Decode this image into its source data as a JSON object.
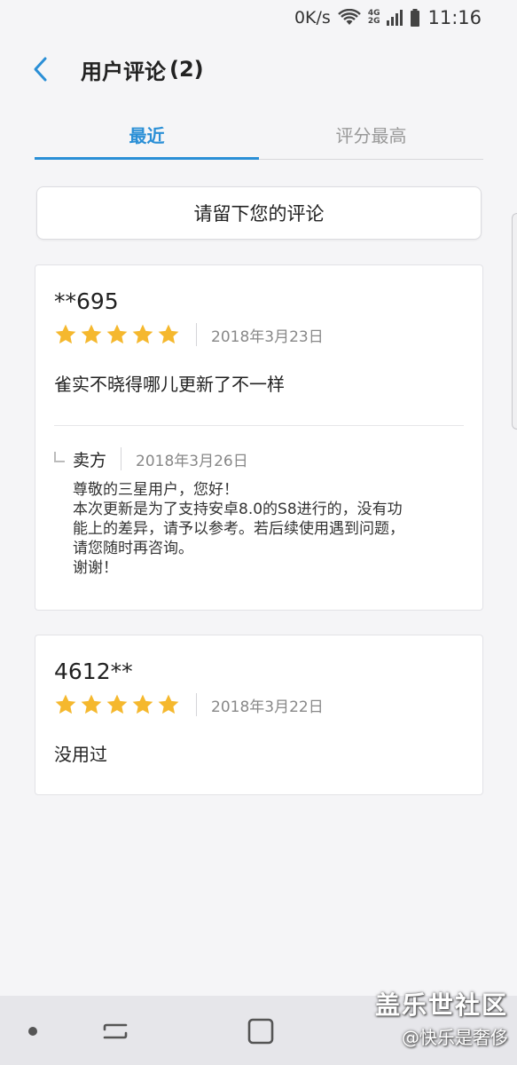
{
  "status_bar": {
    "net_speed": "0K/s",
    "network_label_top": "4G",
    "network_label_bottom": "2G",
    "time": "11:16",
    "icons": [
      "wifi-icon",
      "signal-icon",
      "battery-icon"
    ]
  },
  "header": {
    "back_icon": "chevron-left-icon",
    "title": "用户评论",
    "count": "(2)"
  },
  "tabs": [
    {
      "label": "最近",
      "active": true
    },
    {
      "label": "评分最高",
      "active": false
    }
  ],
  "leave_comment_label": "请留下您的评论",
  "reviews": [
    {
      "reviewer": "**695",
      "rating": 5,
      "max_rating": 5,
      "date": "2018年3月23日",
      "comment": "雀实不晓得哪儿更新了不一样",
      "reply": {
        "author": "卖方",
        "date": "2018年3月26日",
        "lines": [
          "尊敬的三星用户，您好！",
          "本次更新是为了支持安卓8.0的S8进行的，没有功",
          "能上的差异，请予以参考。若后续使用遇到问题，",
          "请您随时再咨询。",
          "谢谢！"
        ]
      }
    },
    {
      "reviewer": "4612**",
      "rating": 5,
      "max_rating": 5,
      "date": "2018年3月22日",
      "comment": "没用过"
    }
  ],
  "watermark": {
    "line1": "盖乐世社区",
    "line2": "@快乐是奢侈"
  },
  "colors": {
    "accent": "#2a8fd6",
    "star": "#f5b82e",
    "background": "#f5f5f7"
  }
}
